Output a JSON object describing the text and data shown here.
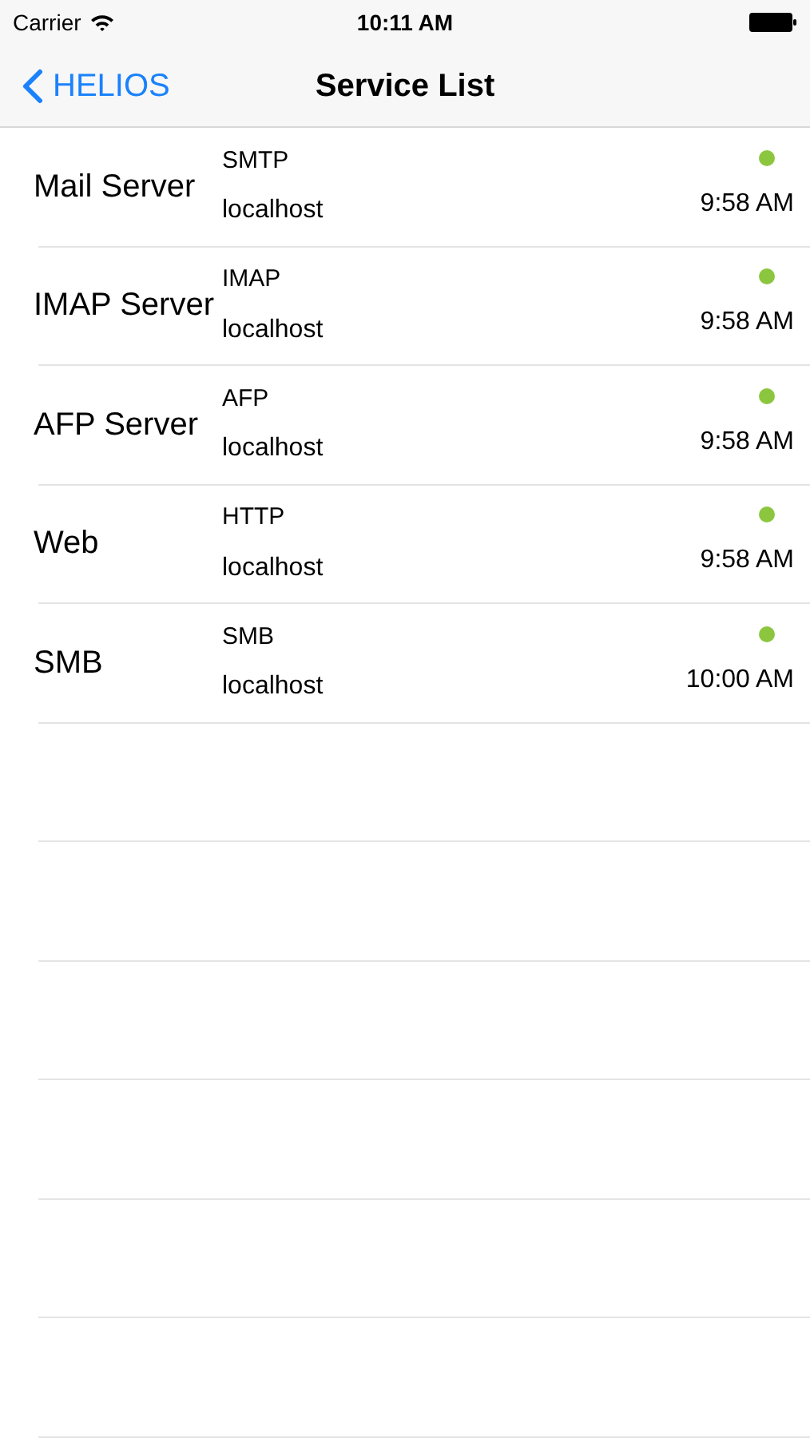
{
  "status_bar": {
    "carrier": "Carrier",
    "time": "10:11 AM"
  },
  "nav_bar": {
    "back_label": "HELIOS",
    "title": "Service List"
  },
  "services": [
    {
      "name": "Mail Server",
      "protocol": "SMTP",
      "host": "localhost",
      "time": "9:58 AM",
      "color": "#8cc63f"
    },
    {
      "name": "IMAP Server",
      "protocol": "IMAP",
      "host": "localhost",
      "time": "9:58 AM",
      "color": "#8cc63f"
    },
    {
      "name": "AFP Server",
      "protocol": "AFP",
      "host": "localhost",
      "time": "9:58 AM",
      "color": "#8cc63f"
    },
    {
      "name": "Web",
      "protocol": "HTTP",
      "host": "localhost",
      "time": "9:58 AM",
      "color": "#8cc63f"
    },
    {
      "name": "SMB",
      "protocol": "SMB",
      "host": "localhost",
      "time": "10:00 AM",
      "color": "#8cc63f"
    }
  ]
}
